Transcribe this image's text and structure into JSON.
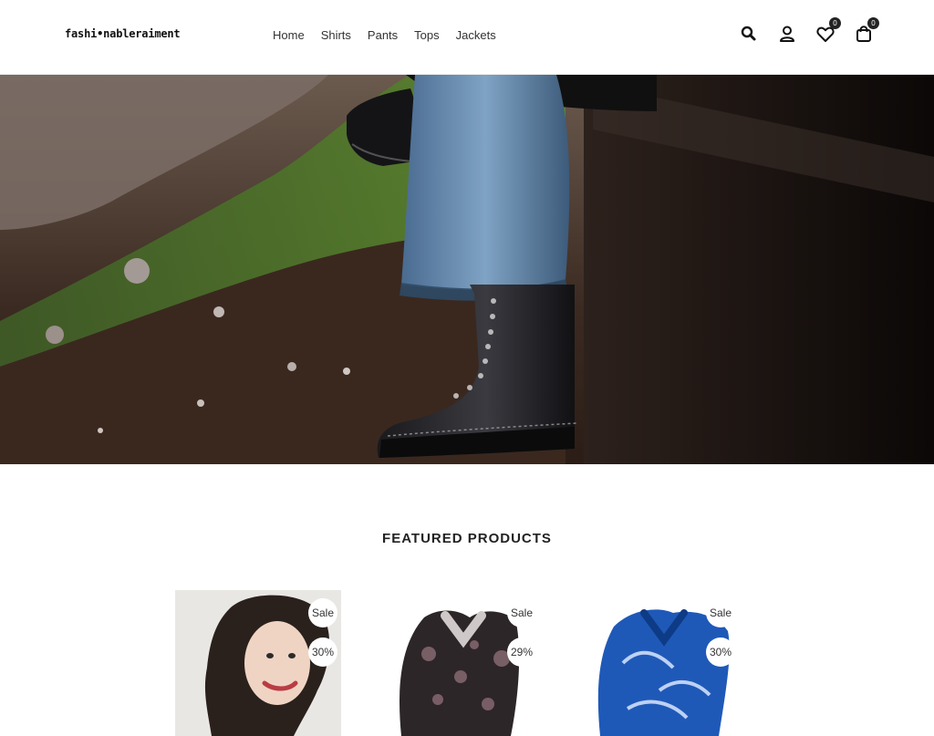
{
  "brand": {
    "logo_text": "fashi•nableraiment"
  },
  "nav": {
    "items": [
      "Home",
      "Shirts",
      "Pants",
      "Tops",
      "Jackets"
    ]
  },
  "header_icons": {
    "wishlist_count": "0",
    "cart_count": "0",
    "icons": [
      "search-icon",
      "user-icon",
      "heart-icon",
      "bag-icon"
    ]
  },
  "featured": {
    "title": "FEATURED PRODUCTS",
    "products": [
      {
        "sale_label": "Sale",
        "discount": "30%"
      },
      {
        "sale_label": "Sale",
        "discount": "29%"
      },
      {
        "sale_label": "Sale",
        "discount": "30%"
      }
    ]
  },
  "colors": {
    "accent": "#222222",
    "background": "#ffffff"
  }
}
